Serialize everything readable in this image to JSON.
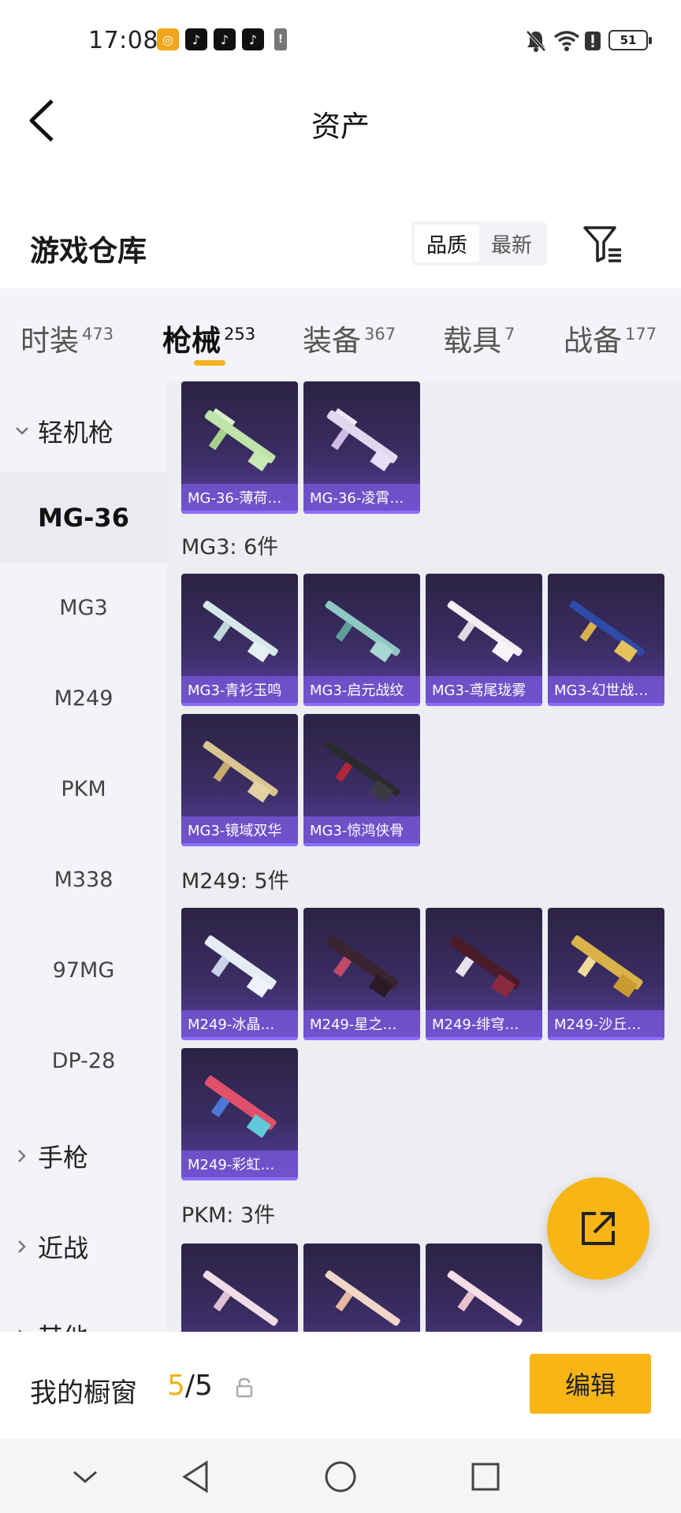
{
  "status_bar": {
    "time": "17:08",
    "battery": "51",
    "icons": [
      "notes-app-icon",
      "tiktok-icon",
      "tiktok-icon",
      "tiktok-icon",
      "warning-icon",
      "mute-bell-icon",
      "wifi-icon",
      "alert-icon",
      "battery-icon"
    ]
  },
  "header": {
    "title": "资产"
  },
  "warehouse": {
    "title": "游戏仓库",
    "sort": {
      "options": [
        "品质",
        "最新"
      ],
      "active": "品质"
    }
  },
  "tabs": [
    {
      "label": "时装",
      "count": "473"
    },
    {
      "label": "枪械",
      "count": "253",
      "active": true
    },
    {
      "label": "装备",
      "count": "367"
    },
    {
      "label": "载具",
      "count": "7"
    },
    {
      "label": "战备",
      "count": "177"
    }
  ],
  "sidebar": {
    "group_open": "轻机枪",
    "items": [
      "MG-36",
      "MG3",
      "M249",
      "PKM",
      "M338",
      "97MG",
      "DP-28"
    ],
    "active_item": "MG-36",
    "groups_closed": [
      "手枪",
      "近战",
      "其他"
    ]
  },
  "sections": [
    {
      "title": "",
      "items": [
        "MG-36-薄荷…",
        "MG-36-凌霄…"
      ]
    },
    {
      "title": "MG3: 6件",
      "items": [
        "MG3-青衫玉鸣",
        "MG3-启元战纹",
        "MG3-鸢尾珑雾",
        "MG3-幻世战…",
        "MG3-镜域双华",
        "MG3-惊鸿侠骨"
      ]
    },
    {
      "title": "M249: 5件",
      "items": [
        "M249-冰晶…",
        "M249-星之…",
        "M249-绯穹…",
        "M249-沙丘…",
        "M249-彩虹…"
      ]
    },
    {
      "title": "PKM: 3件",
      "items": [
        "",
        "",
        ""
      ]
    }
  ],
  "showcase": {
    "label": "我的橱窗",
    "current": "5",
    "total": "/5",
    "edit_label": "编辑"
  },
  "colors": {
    "accent": "#f7b516",
    "card_bg": "#3a2d63",
    "card_label": "#785adc"
  }
}
